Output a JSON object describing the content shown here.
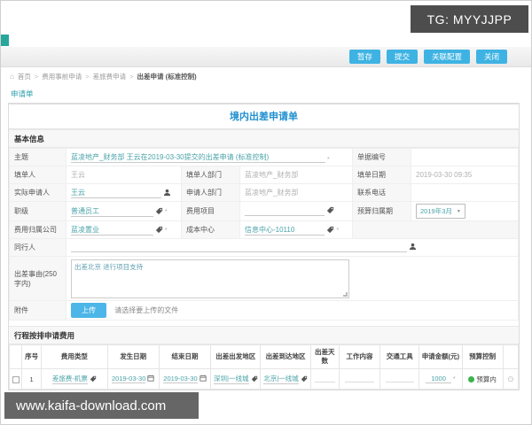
{
  "watermark": {
    "tg": "TG: MYYJJPP",
    "site": "www.kaifa-download.com"
  },
  "toolbar": {
    "buttons": [
      {
        "label": "暂存"
      },
      {
        "label": "提交"
      },
      {
        "label": "关联配置"
      },
      {
        "label": "关闭"
      }
    ]
  },
  "breadcrumb": {
    "home": "首页",
    "separator": ">",
    "items": [
      "费用事前申请",
      "差旅费申请",
      "出差申请 (标准控制)"
    ]
  },
  "tabs": {
    "active": "申请单"
  },
  "icons": {
    "home": "⌂",
    "caret_down": "▼",
    "asterisk": "*",
    "row_circle": "⊙"
  },
  "colors": {
    "accent_blue": "#3eb3e3",
    "title_blue": "#2090d0",
    "link_teal": "#4aa2a8",
    "budget_green": "#3bb44a"
  },
  "form": {
    "title": "境内出差申请单",
    "sections": {
      "basic": "基本信息",
      "trip": "行程按排申请费用"
    },
    "fields": {
      "subject_label": "主题",
      "subject_value": "蓝凌地产_财务部 王云在2019-03-30提交的出差申请 (标准控制)",
      "doc_no_label": "单据编号",
      "doc_no_value": "",
      "filler_label": "填单人",
      "filler_value": "王云",
      "filler_dept_label": "填单人部门",
      "filler_dept_value": "蓝凌地产_财务部",
      "fill_date_label": "填单日期",
      "fill_date_value": "2019-03-30 09:35",
      "applicant_label": "实际申请人",
      "applicant_value": "王云",
      "applicant_dept_label": "申请人部门",
      "applicant_dept_value": "蓝凌地产_财务部",
      "phone_label": "联系电话",
      "phone_value": "",
      "rank_label": "职级",
      "rank_value": "普通员工",
      "expense_item_label": "费用项目",
      "expense_item_value": "",
      "budget_period_label": "预算归属期",
      "budget_period_value": "2019年3月",
      "company_label": "费用归属公司",
      "company_value": "蓝凌置业",
      "cost_center_label": "成本中心",
      "cost_center_value": "信息中心-10110",
      "companion_label": "同行人",
      "companion_value": "",
      "reason_label": "出差事由(250字内)",
      "reason_value": "出差北京 进行项目支持",
      "attachment_label": "附件",
      "upload_button": "上传",
      "upload_hint": "请选择要上传的文件"
    },
    "trip": {
      "headers": [
        "序号",
        "费用类型",
        "发生日期",
        "结束日期",
        "出差出发地区",
        "出差到达地区",
        "出差天数",
        "工作内容",
        "交通工具",
        "申请金额(元)",
        "预算控制"
      ],
      "rows": [
        {
          "no": "1",
          "expense_type": "差旅费-机票",
          "start_date": "2019-03-30",
          "end_date": "2019-03-30",
          "from_region": "深圳|一线城",
          "to_region": "北京|一线城",
          "days": "",
          "work": "",
          "transport": "",
          "amount": "1000",
          "budget_status": "预算内"
        }
      ]
    }
  }
}
